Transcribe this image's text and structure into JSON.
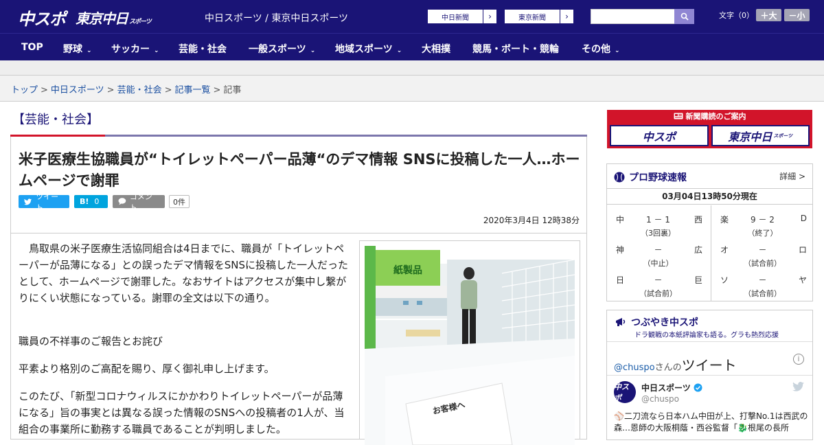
{
  "header": {
    "logo_chunichi": "中スポ",
    "logo_tokyo": "東京中日",
    "logo_tokyo_small": "スポーツ",
    "site_title": "中日スポーツ / 東京中日スポーツ",
    "ext_links": [
      {
        "label": "中日新聞",
        "arrow": "›"
      },
      {
        "label": "東京新聞",
        "arrow": "›"
      }
    ],
    "search_placeholder": "",
    "font_size_label": "文字（0）",
    "font_bigger": "＋大",
    "font_smaller": "－小"
  },
  "nav": [
    {
      "label": "TOP",
      "chevron": ""
    },
    {
      "label": "野球",
      "chevron": "⌄"
    },
    {
      "label": "サッカー",
      "chevron": "⌄"
    },
    {
      "label": "芸能・社会",
      "chevron": ""
    },
    {
      "label": "一般スポーツ",
      "chevron": "⌄"
    },
    {
      "label": "地域スポーツ",
      "chevron": "⌄"
    },
    {
      "label": "大相撲",
      "chevron": ""
    },
    {
      "label": "競馬・ボート・競輪",
      "chevron": ""
    },
    {
      "label": "その他",
      "chevron": "⌄"
    }
  ],
  "breadcrumb": {
    "items": [
      "トップ",
      "中日スポーツ",
      "芸能・社会",
      "記事一覧"
    ],
    "current": "記事",
    "sep": ">"
  },
  "section": {
    "title": "【芸能・社会】"
  },
  "article": {
    "headline": "米子医療生協職員が“トイレットペーパー品薄“のデマ情報 SNSに投稿した一人…ホームページで謝罪",
    "tweet_label": "ツイート",
    "hatena_label": "B!",
    "hatena_count": "0",
    "comment_label": "コメント",
    "comment_count": "0件",
    "date": "2020年3月4日 12時38分",
    "paragraphs": [
      "　鳥取県の米子医療生活協同組合は4日までに、職員が「トイレットペーパーが品薄になる」との誤ったデマ情報をSNSに投稿した一人だったとして、ホームページで謝罪した。なおサイトはアクセスが集中し繋がりにくい状態になっている。謝罪の全文は以下の通り。",
      "職員の不祥事のご報告とお詫び",
      "平素より格別のご高配を賜り、厚く御礼申し上げます。",
      "このたび、「新型コロナウィルスにかかわりトイレットペーパーが品薄になる」旨の事実とは異なる誤った情報のSNSへの投稿者の1人が、当組合の事業所に勤務する職員であることが判明しました。"
    ],
    "photo_sign": "紙製品",
    "photo_notice": "お客様へ"
  },
  "sidebar": {
    "subscribe_header": "新聞購読のご案内",
    "subscribe_logo1": "中スポ",
    "subscribe_logo2": "東京中日",
    "subscribe_logo2_small": "スポーツ",
    "baseball": {
      "title": "プロ野球速報",
      "more": "詳細 >",
      "as_of": "03月04日13時50分現在",
      "games": [
        {
          "home": "中",
          "score": "1 － 1",
          "away": "西",
          "status": "（3回裏）"
        },
        {
          "home": "楽",
          "score": "9 － 2",
          "away": "D",
          "status": "（終了）"
        },
        {
          "home": "神",
          "score": "－",
          "away": "広",
          "status": "（中止）"
        },
        {
          "home": "オ",
          "score": "－",
          "away": "ロ",
          "status": "（試合前）"
        },
        {
          "home": "日",
          "score": "－",
          "away": "巨",
          "status": "（試合前）"
        },
        {
          "home": "ソ",
          "score": "－",
          "away": "ヤ",
          "status": "（試合前）"
        }
      ]
    },
    "twitter": {
      "title": "つぶやき中スポ",
      "subtitle": "ドラ観戦の本紙評論家も語る。グラも熱烈応援",
      "handle": "@chuspo",
      "handle_suffix": "さんの",
      "tweets_word": "ツイート",
      "info": "i",
      "avatar_text": "中スポ",
      "account_name": "中日スポーツ",
      "account_at": "@chuspo",
      "tweet_text": "⚾二刀流なら日本ハム中田が上、打撃No.1は西武の森…恩師の大阪桐蔭・西谷監督「🐉根尾の長所"
    }
  },
  "colors": {
    "brand_navy": "#1a1476",
    "accent_red": "#d2142a",
    "twitter_blue": "#1da1f2",
    "hatena_blue": "#00a4de"
  }
}
